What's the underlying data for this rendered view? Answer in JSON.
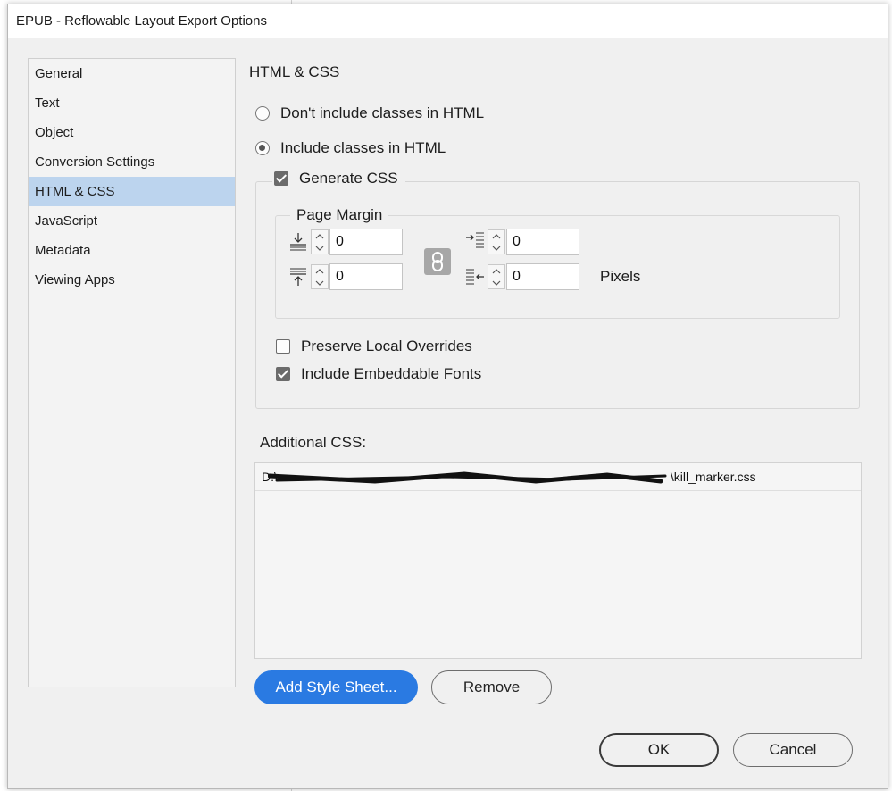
{
  "window": {
    "title": "EPUB - Reflowable Layout Export Options"
  },
  "nav": {
    "items": [
      {
        "label": "General"
      },
      {
        "label": "Text"
      },
      {
        "label": "Object"
      },
      {
        "label": "Conversion Settings"
      },
      {
        "label": "HTML & CSS"
      },
      {
        "label": "JavaScript"
      },
      {
        "label": "Metadata"
      },
      {
        "label": "Viewing Apps"
      }
    ],
    "selected": "HTML & CSS"
  },
  "section": {
    "title": "HTML & CSS"
  },
  "classes_option": {
    "dont_include_label": "Don't include classes in HTML",
    "include_label": "Include classes in HTML",
    "selected": "include"
  },
  "generate_css": {
    "label": "Generate CSS",
    "checked": true
  },
  "page_margin": {
    "legend": "Page Margin",
    "top": "0",
    "bottom": "0",
    "left": "0",
    "right": "0",
    "units_label": "Pixels"
  },
  "preserve_local_overrides": {
    "label": "Preserve Local Overrides",
    "checked": false
  },
  "include_embeddable_fonts": {
    "label": "Include Embeddable Fonts",
    "checked": true
  },
  "additional_css": {
    "label": "Additional CSS:",
    "entries": [
      {
        "prefix": "D:\\",
        "suffix": "\\kill_marker.css"
      }
    ]
  },
  "buttons": {
    "add_style_sheet": "Add Style Sheet...",
    "remove": "Remove",
    "ok": "OK",
    "cancel": "Cancel"
  },
  "colors": {
    "accent": "#2a7ae2",
    "nav_selected": "#bcd4ee",
    "dialog_bg": "#f0f0f0"
  }
}
